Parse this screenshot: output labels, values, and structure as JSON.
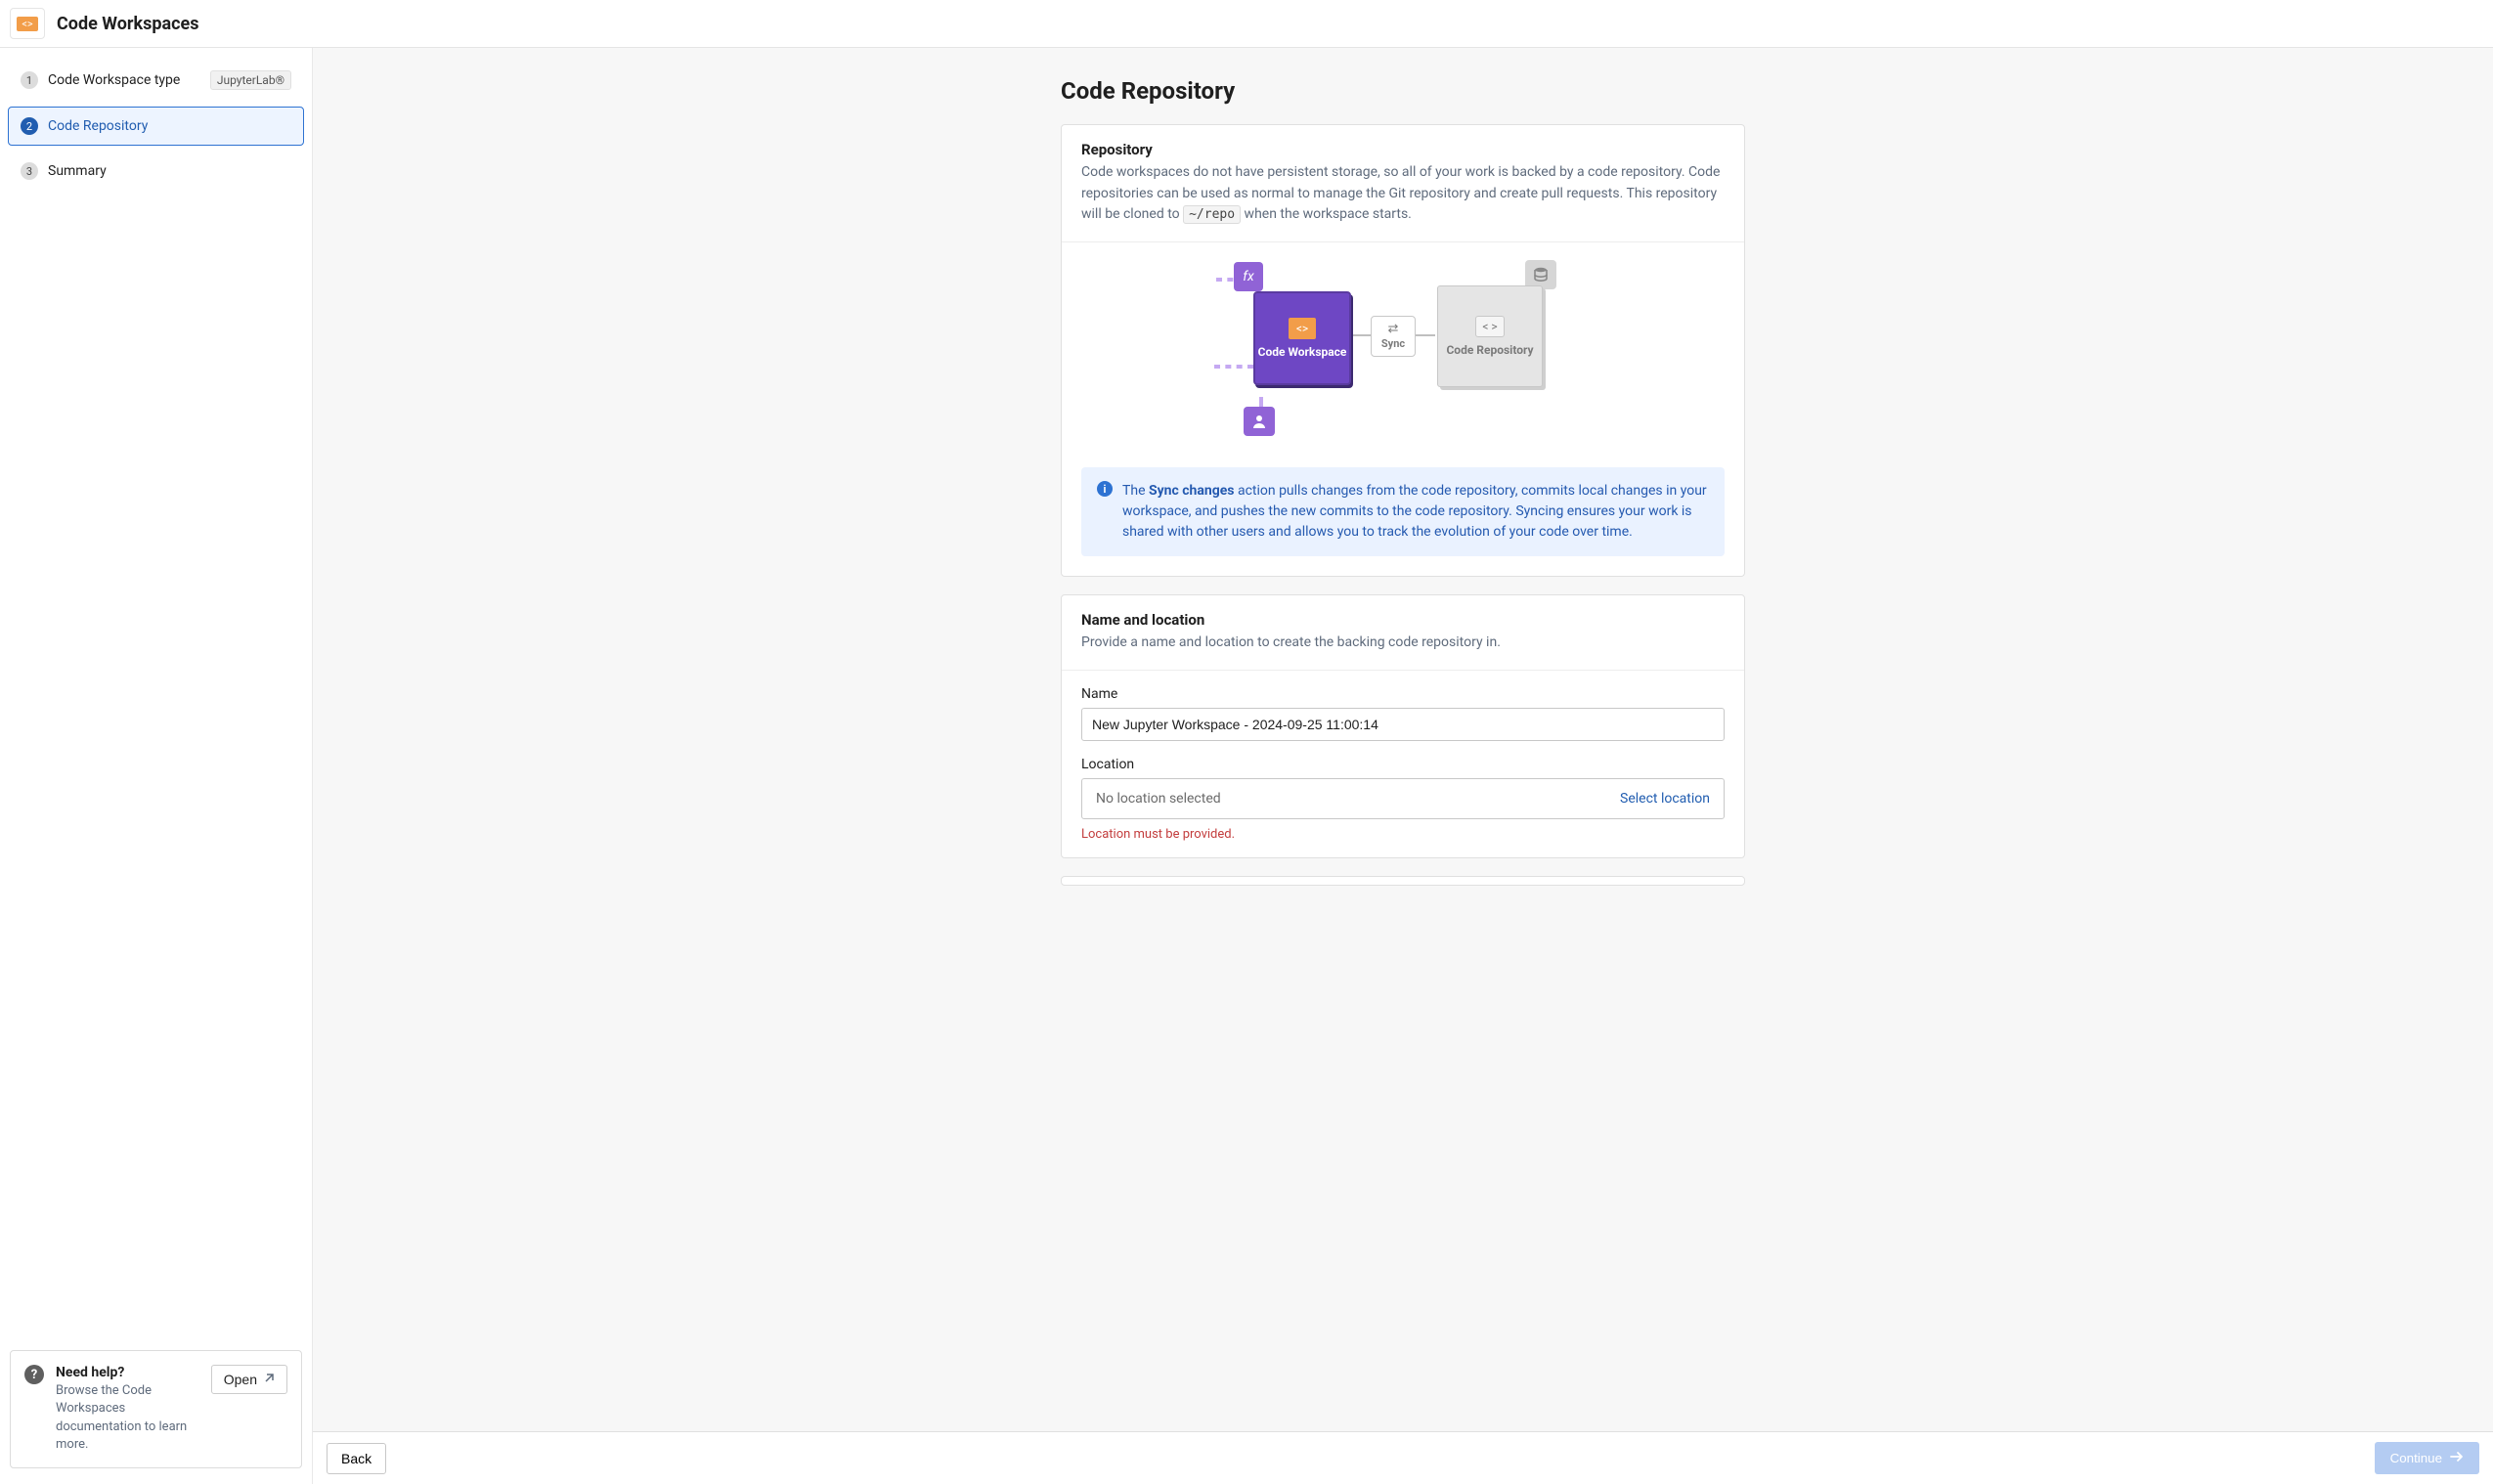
{
  "header": {
    "title": "Code Workspaces"
  },
  "steps": {
    "items": [
      {
        "label": "Code Workspace type",
        "badge": "JupyterLab®"
      },
      {
        "label": "Code Repository"
      },
      {
        "label": "Summary"
      }
    ]
  },
  "help": {
    "title": "Need help?",
    "desc": "Browse the Code Workspaces documentation to learn more.",
    "button": "Open"
  },
  "page": {
    "title": "Code Repository",
    "repo_section": {
      "title": "Repository",
      "desc_pre": "Code workspaces do not have persistent storage, so all of your work is backed by a code repository. Code repositories can be used as normal to manage the Git repository and create pull requests. This repository will be cloned to ",
      "desc_code": "~/repo",
      "desc_post": " when the workspace starts."
    },
    "diagram": {
      "workspace": "Code Workspace",
      "repository": "Code Repository",
      "sync": "Sync",
      "fx": "fx"
    },
    "callout": {
      "pre": "The ",
      "bold": "Sync changes",
      "post": " action pulls changes from the code repository, commits local changes in your workspace, and pushes the new commits to the code repository. Syncing ensures your work is shared with other users and allows you to track the evolution of your code over time."
    },
    "name_loc": {
      "title": "Name and location",
      "desc": "Provide a name and location to create the backing code repository in.",
      "name_label": "Name",
      "name_value": "New Jupyter Workspace - 2024-09-25 11:00:14",
      "location_label": "Location",
      "location_placeholder": "No location selected",
      "location_select": "Select location",
      "location_error": "Location must be provided."
    }
  },
  "footer": {
    "back": "Back",
    "continue": "Continue"
  }
}
